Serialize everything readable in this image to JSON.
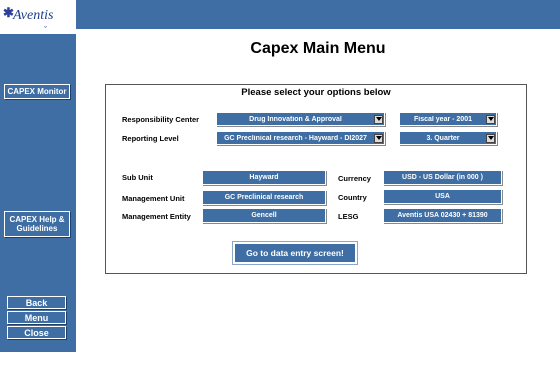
{
  "brand": {
    "logo_text": "Aventis"
  },
  "sidebar": {
    "capex_monitor": "CAPEX Monitor",
    "capex_help": "CAPEX Help & Guidelines",
    "back": "Back",
    "menu": "Menu",
    "close": "Close"
  },
  "main": {
    "title": "Capex Main Menu",
    "subtitle": "Please select your options below",
    "responsibility_center": {
      "label": "Responsibility Center",
      "value": "Drug Innovation & Approval"
    },
    "fiscal_year": {
      "value": "Fiscal year - 2001"
    },
    "reporting_level": {
      "label": "Reporting Level",
      "value": "GC Preclinical research - Hayward - DI2027"
    },
    "quarter": {
      "value": "3. Quarter"
    },
    "sub_unit": {
      "label": "Sub Unit",
      "value": "Hayward"
    },
    "management_unit": {
      "label": "Management Unit",
      "value": "GC Preclinical research"
    },
    "management_entity": {
      "label": "Management Entity",
      "value": "Gencell"
    },
    "currency": {
      "label": "Currency",
      "value": "USD - US Dollar     (in 000 )"
    },
    "country": {
      "label": "Country",
      "value": "USA"
    },
    "lesg": {
      "label": "LESG",
      "value": "Aventis USA 02430 + 81390"
    },
    "go_button": "Go to data entry screen!"
  },
  "colors": {
    "primary": "#3e6ea3",
    "background": "#ffffff"
  }
}
